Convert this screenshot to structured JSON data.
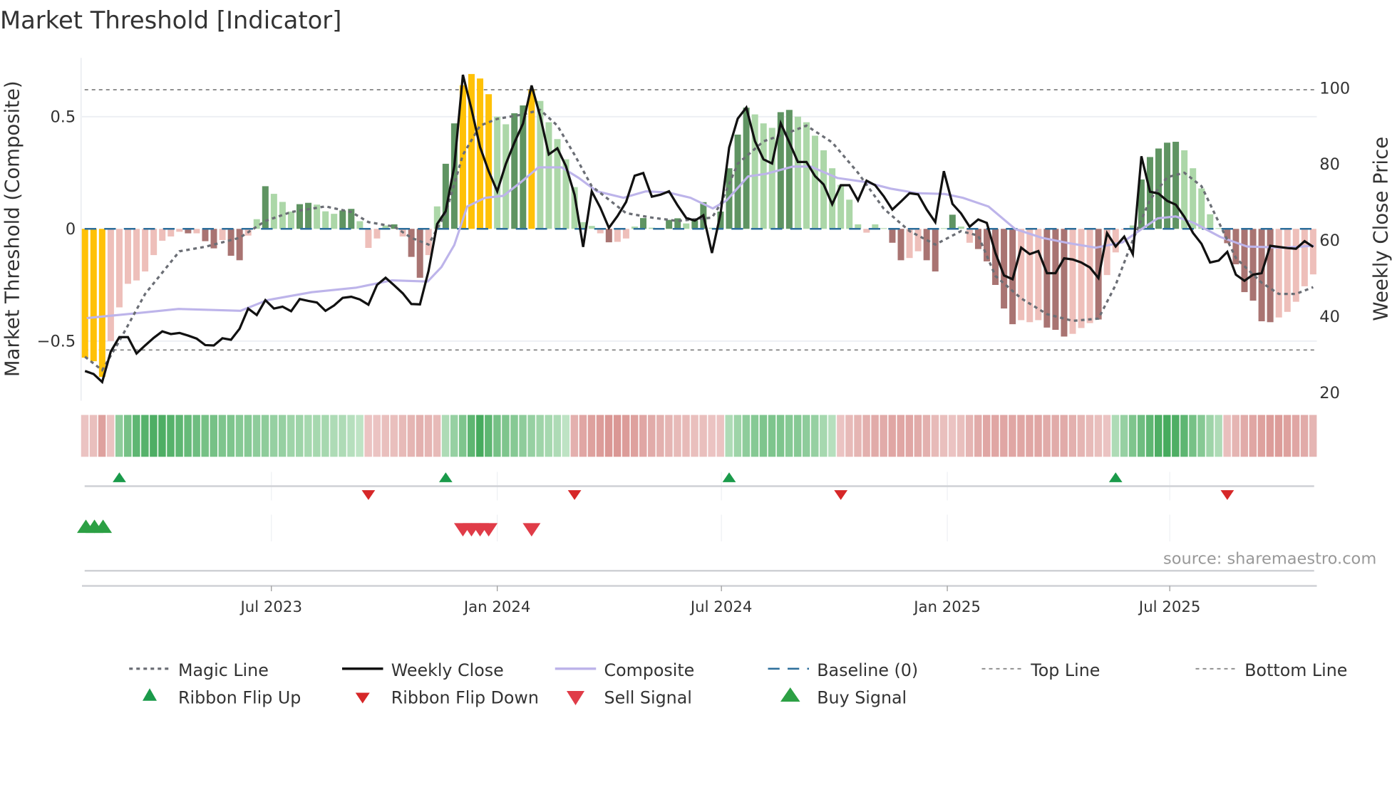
{
  "chart_data": {
    "type": "bar+line",
    "title": "Market Threshold [Indicator]",
    "ylabel_left": "Market Threshold (Composite)",
    "ylabel_right": "Weekly Close Price",
    "source": "source: sharemaestro.com",
    "ylim_left": [
      -0.75,
      0.75
    ],
    "ylim_right": [
      20,
      100
    ],
    "left_ticks": [
      {
        "value": 0.5,
        "label": "0.5"
      },
      {
        "value": 0,
        "label": "0"
      },
      {
        "value": -0.5,
        "label": "−0.5"
      }
    ],
    "right_ticks": [
      {
        "value": 100,
        "label": "100"
      },
      {
        "value": 80,
        "label": "80"
      },
      {
        "value": 60,
        "label": "60"
      },
      {
        "value": 40,
        "label": "40"
      },
      {
        "value": 20,
        "label": "20"
      }
    ],
    "x_unit": "week index (1 = first weekly bar)",
    "x_ticks": [
      {
        "week": 22.7,
        "label": "Jul 2023"
      },
      {
        "week": 49.0,
        "label": "Jan 2024"
      },
      {
        "week": 75.1,
        "label": "Jul 2024"
      },
      {
        "week": 101.4,
        "label": "Jan 2025"
      },
      {
        "week": 127.3,
        "label": "Jul 2025"
      }
    ],
    "top_line": 0.62,
    "bottom_line": -0.54,
    "baseline": 0,
    "colors": {
      "extreme": "#FFC107",
      "strong_up": "#5f9462",
      "weak_up": "#acd7a8",
      "strong_down": "#a97472",
      "weak_down": "#eebfba",
      "weekly_close": "#111111",
      "composite_line": "#bdb4ea",
      "magic_line": "#6b6e75",
      "baseline": "#2c6e9b",
      "threshold_lines": "#8a8a8a",
      "ribbon_up_light": "#d6eed8",
      "ribbon_up_strong": "#36a350",
      "ribbon_down_light": "#f3d7d7",
      "ribbon_down_strong": "#cc7570",
      "flip_up": "#1a9a4a",
      "flip_down": "#d62728",
      "sell": "#e03c48",
      "buy": "#2ca044"
    },
    "composite_bars": [
      -0.574,
      -0.59,
      -0.66,
      -0.5,
      -0.35,
      -0.245,
      -0.23,
      -0.19,
      -0.117,
      -0.053,
      -0.034,
      -0.013,
      -0.02,
      -0.02,
      -0.055,
      -0.087,
      -0.05,
      -0.12,
      -0.14,
      -0.03,
      0.043,
      0.19,
      0.156,
      0.12,
      0.077,
      0.11,
      0.116,
      0.108,
      0.078,
      0.067,
      0.082,
      0.089,
      0.034,
      -0.085,
      -0.043,
      0.015,
      0.02,
      -0.034,
      -0.125,
      -0.218,
      -0.117,
      0.1,
      0.29,
      0.47,
      0.64,
      0.69,
      0.67,
      0.6,
      0.5,
      0.466,
      0.515,
      0.55,
      0.62,
      0.57,
      0.475,
      0.4,
      0.31,
      0.186,
      0.03,
      0.013,
      -0.02,
      -0.06,
      -0.058,
      -0.043,
      0.01,
      0.048,
      0.005,
      0.003,
      0.04,
      0.047,
      0.024,
      0.037,
      0.119,
      0.005,
      0.077,
      0.27,
      0.42,
      0.54,
      0.51,
      0.47,
      0.45,
      0.52,
      0.53,
      0.5,
      0.475,
      0.415,
      0.35,
      0.27,
      0.196,
      0.13,
      0.02,
      -0.017,
      0.02,
      0.003,
      -0.062,
      -0.14,
      -0.13,
      -0.1,
      -0.14,
      -0.19,
      0.003,
      0.063,
      0.01,
      -0.062,
      -0.09,
      -0.145,
      -0.25,
      -0.355,
      -0.425,
      -0.407,
      -0.416,
      -0.407,
      -0.44,
      -0.45,
      -0.48,
      -0.468,
      -0.442,
      -0.42,
      -0.404,
      -0.206,
      -0.105,
      -0.005,
      0.015,
      0.22,
      0.32,
      0.358,
      0.384,
      0.388,
      0.35,
      0.27,
      0.18,
      0.065,
      0.003,
      -0.064,
      -0.158,
      -0.282,
      -0.32,
      -0.412,
      -0.416,
      -0.395,
      -0.37,
      -0.325,
      -0.256,
      -0.203
    ],
    "bar_class": [
      "Y",
      "Y",
      "Y",
      "P",
      "P",
      "P",
      "P",
      "P",
      "P",
      "P",
      "P",
      "P",
      "DR",
      "P",
      "DR",
      "DR",
      "P",
      "DR",
      "DR",
      "P",
      "LG",
      "DG",
      "LG",
      "LG",
      "LG",
      "DG",
      "DG",
      "LG",
      "LG",
      "LG",
      "DG",
      "DG",
      "LG",
      "P",
      "P",
      "LG",
      "DG",
      "P",
      "DR",
      "DR",
      "P",
      "LG",
      "DG",
      "DG",
      "Y",
      "Y",
      "Y",
      "Y",
      "LG",
      "LG",
      "DG",
      "DG",
      "Y",
      "LG",
      "LG",
      "LG",
      "LG",
      "LG",
      "LG",
      "LG",
      "P",
      "DR",
      "P",
      "P",
      "LG",
      "DG",
      "LG",
      "LG",
      "DG",
      "DG",
      "LG",
      "DG",
      "DG",
      "LG",
      "DG",
      "DG",
      "DG",
      "DG",
      "LG",
      "LG",
      "LG",
      "DG",
      "DG",
      "LG",
      "LG",
      "LG",
      "LG",
      "LG",
      "LG",
      "LG",
      "LG",
      "P",
      "LG",
      "LG",
      "DR",
      "DR",
      "P",
      "P",
      "DR",
      "DR",
      "LG",
      "DG",
      "LG",
      "P",
      "DR",
      "DR",
      "DR",
      "DR",
      "DR",
      "P",
      "P",
      "P",
      "DR",
      "DR",
      "DR",
      "P",
      "P",
      "P",
      "DR",
      "P",
      "P",
      "P",
      "LG",
      "DG",
      "DG",
      "DG",
      "DG",
      "DG",
      "LG",
      "LG",
      "LG",
      "LG",
      "LG",
      "DR",
      "DR",
      "DR",
      "DR",
      "DR",
      "DR",
      "P",
      "P",
      "P",
      "P",
      "P"
    ],
    "weekly_close": [
      25.7,
      24.9,
      22.8,
      30.8,
      34.6,
      34.6,
      30.3,
      32.4,
      34.4,
      36.1,
      35.4,
      35.7,
      35.0,
      34.2,
      32.5,
      32.4,
      34.3,
      33.9,
      36.8,
      42.1,
      40.4,
      44.3,
      42.1,
      42.6,
      41.4,
      44.6,
      44.1,
      43.7,
      41.5,
      42.9,
      44.9,
      45.2,
      44.5,
      43.1,
      48.3,
      50.2,
      48.2,
      46.1,
      43.3,
      43.2,
      52.0,
      64.3,
      67.7,
      79.5,
      103.5,
      94.5,
      84.5,
      78.2,
      72.9,
      80.1,
      85.7,
      90.7,
      100.7,
      92.6,
      82.6,
      84.2,
      79.5,
      72.0,
      58.3,
      72.9,
      68.6,
      63.3,
      66.4,
      70.1,
      77.0,
      77.7,
      71.5,
      72.0,
      72.9,
      69.2,
      65.9,
      65.2,
      66.6,
      56.7,
      67.0,
      84.4,
      92.0,
      94.9,
      86.1,
      81.3,
      80.2,
      90.8,
      85.8,
      80.6,
      80.6,
      76.9,
      74.7,
      69.5,
      74.5,
      74.5,
      70.5,
      75.7,
      74.5,
      71.6,
      68.1,
      70.2,
      72.4,
      72.1,
      68.1,
      64.8,
      78.2,
      69.6,
      67.1,
      63.6,
      65.5,
      64.6,
      56.7,
      50.8,
      49.8,
      58.1,
      56.4,
      57.2,
      51.4,
      51.4,
      55.3,
      55.0,
      54.2,
      52.9,
      50.1,
      61.9,
      58.4,
      61.0,
      56.4,
      82.1,
      72.8,
      72.3,
      70.4,
      69.4,
      66.2,
      62.0,
      59.1,
      54.2,
      54.7,
      57.0,
      51.0,
      49.4,
      51.0,
      51.4,
      58.6,
      58.3,
      58.0,
      57.8,
      59.8,
      58.3
    ],
    "composite_line": [
      [
        1.2,
        39.6
      ],
      [
        6.7,
        40.8
      ],
      [
        11.9,
        42.0
      ],
      [
        19.1,
        41.5
      ],
      [
        22.2,
        44.3
      ],
      [
        27.4,
        46.4
      ],
      [
        32.6,
        47.6
      ],
      [
        36.7,
        49.5
      ],
      [
        40.9,
        49.2
      ],
      [
        42.5,
        53.0
      ],
      [
        44.0,
        58.8
      ],
      [
        45.5,
        68.9
      ],
      [
        47.6,
        71.2
      ],
      [
        49.7,
        71.7
      ],
      [
        51.7,
        75.2
      ],
      [
        53.8,
        79.2
      ],
      [
        56.5,
        79.2
      ],
      [
        58.5,
        76.4
      ],
      [
        60.6,
        72.9
      ],
      [
        63.7,
        71.2
      ],
      [
        66.3,
        72.9
      ],
      [
        68.9,
        72.6
      ],
      [
        71.5,
        71.2
      ],
      [
        74.1,
        68.4
      ],
      [
        75.7,
        70.5
      ],
      [
        78.2,
        76.8
      ],
      [
        80.3,
        77.5
      ],
      [
        83.4,
        79.4
      ],
      [
        85.5,
        79.4
      ],
      [
        88.6,
        76.4
      ],
      [
        91.7,
        75.4
      ],
      [
        94.8,
        73.6
      ],
      [
        97.9,
        72.4
      ],
      [
        101.1,
        72.2
      ],
      [
        103.2,
        71.2
      ],
      [
        106.2,
        68.9
      ],
      [
        109.3,
        63.0
      ],
      [
        112.4,
        60.7
      ],
      [
        115.5,
        59.3
      ],
      [
        118.7,
        58.1
      ],
      [
        121.8,
        59.5
      ],
      [
        123.9,
        62.8
      ],
      [
        125.9,
        65.8
      ],
      [
        128.0,
        66.3
      ],
      [
        130.1,
        64.6
      ],
      [
        133.2,
        60.9
      ],
      [
        136.3,
        58.4
      ],
      [
        140.5,
        58.1
      ],
      [
        144.1,
        58.6
      ]
    ],
    "magic_line": [
      [
        1,
        -0.57
      ],
      [
        3,
        -0.63
      ],
      [
        5,
        -0.5
      ],
      [
        8,
        -0.29
      ],
      [
        12,
        -0.1
      ],
      [
        15,
        -0.08
      ],
      [
        19,
        -0.04
      ],
      [
        22,
        0.035
      ],
      [
        25,
        0.075
      ],
      [
        29,
        0.1
      ],
      [
        32,
        0.075
      ],
      [
        34,
        0.03
      ],
      [
        37,
        0.01
      ],
      [
        39,
        -0.04
      ],
      [
        41,
        -0.07
      ],
      [
        43,
        0.07
      ],
      [
        45,
        0.33
      ],
      [
        47,
        0.46
      ],
      [
        49,
        0.49
      ],
      [
        52,
        0.51
      ],
      [
        54,
        0.53
      ],
      [
        56,
        0.46
      ],
      [
        58,
        0.33
      ],
      [
        60,
        0.19
      ],
      [
        64,
        0.07
      ],
      [
        67,
        0.05
      ],
      [
        70,
        0.035
      ],
      [
        74,
        0.05
      ],
      [
        75,
        0.11
      ],
      [
        77,
        0.29
      ],
      [
        80,
        0.39
      ],
      [
        83,
        0.43
      ],
      [
        85,
        0.46
      ],
      [
        88,
        0.385
      ],
      [
        91,
        0.25
      ],
      [
        94,
        0.09
      ],
      [
        97,
        -0.01
      ],
      [
        100,
        -0.07
      ],
      [
        103,
        -0.01
      ],
      [
        105,
        -0.03
      ],
      [
        107,
        -0.21
      ],
      [
        110,
        -0.31
      ],
      [
        113,
        -0.38
      ],
      [
        116,
        -0.41
      ],
      [
        119,
        -0.4
      ],
      [
        121,
        -0.25
      ],
      [
        123,
        -0.05
      ],
      [
        125,
        0.13
      ],
      [
        127,
        0.23
      ],
      [
        129,
        0.25
      ],
      [
        131,
        0.19
      ],
      [
        133,
        0.03
      ],
      [
        135,
        -0.13
      ],
      [
        138,
        -0.24
      ],
      [
        140,
        -0.29
      ],
      [
        142,
        -0.29
      ],
      [
        144,
        -0.26
      ]
    ],
    "ribbon": [
      -0.2,
      -0.25,
      -0.55,
      -0.2,
      0.45,
      0.6,
      0.75,
      0.8,
      0.85,
      0.85,
      0.8,
      0.75,
      0.7,
      0.65,
      0.6,
      0.6,
      0.55,
      0.55,
      0.5,
      0.5,
      0.45,
      0.45,
      0.4,
      0.4,
      0.35,
      0.35,
      0.3,
      0.3,
      0.3,
      0.25,
      0.25,
      0.2,
      0.15,
      -0.2,
      -0.2,
      -0.25,
      -0.25,
      -0.3,
      -0.35,
      -0.4,
      -0.35,
      -0.3,
      0.25,
      0.4,
      0.55,
      0.75,
      0.9,
      0.75,
      0.6,
      0.55,
      0.5,
      0.45,
      0.4,
      0.35,
      0.3,
      0.25,
      0.15,
      -0.4,
      -0.5,
      -0.55,
      -0.6,
      -0.65,
      -0.65,
      -0.6,
      -0.55,
      -0.5,
      -0.45,
      -0.4,
      -0.35,
      -0.3,
      -0.3,
      -0.25,
      -0.25,
      -0.2,
      -0.2,
      0.25,
      0.35,
      0.45,
      0.5,
      0.55,
      0.55,
      0.55,
      0.5,
      0.5,
      0.45,
      0.4,
      0.3,
      0.2,
      -0.2,
      -0.3,
      -0.35,
      -0.4,
      -0.45,
      -0.45,
      -0.5,
      -0.5,
      -0.5,
      -0.45,
      -0.4,
      -0.3,
      -0.25,
      -0.2,
      -0.25,
      -0.35,
      -0.45,
      -0.5,
      -0.5,
      -0.5,
      -0.5,
      -0.5,
      -0.5,
      -0.5,
      -0.45,
      -0.45,
      -0.45,
      -0.4,
      -0.35,
      -0.3,
      -0.25,
      -0.2,
      0.25,
      0.4,
      0.55,
      0.65,
      0.75,
      0.85,
      0.9,
      0.85,
      0.75,
      0.6,
      0.5,
      0.35,
      0.25,
      -0.25,
      -0.35,
      -0.45,
      -0.5,
      -0.55,
      -0.6,
      -0.6,
      -0.55,
      -0.5,
      -0.45,
      -0.35
    ],
    "ribbon_flip_up_weeks": [
      5,
      43,
      76,
      121
    ],
    "ribbon_flip_down_weeks": [
      34,
      58,
      89,
      134
    ],
    "buy_signal_weeks": [
      1,
      2,
      3
    ],
    "sell_signal_weeks": [
      45,
      46,
      47,
      48,
      53
    ],
    "legend": {
      "placement": "bottom",
      "items": [
        {
          "label": "Magic Line",
          "symbol": "dotted-line"
        },
        {
          "label": "Weekly Close",
          "symbol": "solid-line"
        },
        {
          "label": "Composite",
          "symbol": "lavender-line"
        },
        {
          "label": "Baseline (0)",
          "symbol": "dashed-line"
        },
        {
          "label": "Top Line",
          "symbol": "thin-dotted-line"
        },
        {
          "label": "Bottom Line",
          "symbol": "thin-dotted-line"
        },
        {
          "label": "Ribbon Flip Up",
          "symbol": "triangle-up"
        },
        {
          "label": "Ribbon Flip Down",
          "symbol": "triangle-down"
        },
        {
          "label": "Sell Signal",
          "symbol": "triangle-down-large"
        },
        {
          "label": "Buy Signal",
          "symbol": "triangle-up-large"
        }
      ]
    }
  }
}
